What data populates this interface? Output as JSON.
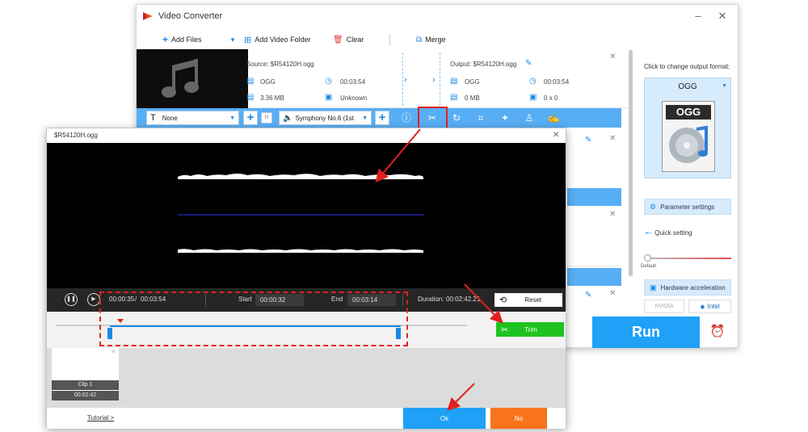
{
  "app": {
    "title": "Video Converter"
  },
  "toolbar": {
    "add_files": "Add Files",
    "add_video_folder": "Add Video Folder",
    "clear": "Clear",
    "merge": "Merge"
  },
  "file": {
    "source_label": "Source: $R54120H.ogg",
    "output_label": "Output: $R54120H.ogg",
    "source": {
      "format": "OGG",
      "duration": "00:03:54",
      "size": "3.36 MB",
      "resolution": "Unknown"
    },
    "output": {
      "format": "OGG",
      "duration": "00:03:54",
      "size": "0 MB",
      "resolution": "0 x 0"
    }
  },
  "edit_bar": {
    "subtitle": "None",
    "audio_track": "Symphony No.6 (1st"
  },
  "right_panel": {
    "change_format_label": "Click to change output format:",
    "format": "OGG",
    "format_icon_text": "OGG",
    "parameter_settings": "Parameter settings",
    "quick_setting": "Quick setting",
    "slider_default": "Default",
    "hardware_acceleration": "Hardware acceleration",
    "nvidia": "NVIDIA",
    "intel": "Intel",
    "run": "Run"
  },
  "trim": {
    "window_title": "$R54120H.ogg",
    "current_time": "00:00:35",
    "separator": "/",
    "total_time": "00:03:54",
    "start_label": "Start",
    "start_value": "00:00:32",
    "end_label": "End",
    "end_value": "00:03:14",
    "duration_label": "Duration:",
    "duration_value": "00:02:42.21",
    "reset": "Reset",
    "trim": "Trim",
    "clip_name": "Clip 1",
    "clip_duration": "00:02:42",
    "tutorial": "Tutorial >",
    "ok": "Ok",
    "no": "No"
  },
  "colors": {
    "accent_blue": "#1ea1f7",
    "trim_green": "#1fc31f",
    "no_orange": "#f7731c",
    "annotation_red": "#e02020"
  }
}
